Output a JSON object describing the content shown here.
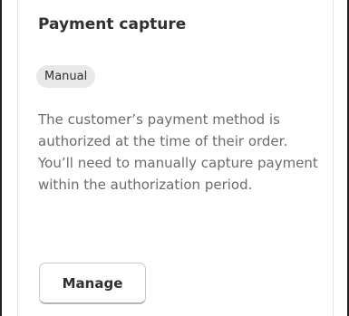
{
  "card": {
    "title": "Payment capture",
    "badge": "Manual",
    "description": "The customer’s payment method is authorized at the time of their order. You’ll need to manually capture payment within the authorization period.",
    "manage_label": "Manage"
  }
}
